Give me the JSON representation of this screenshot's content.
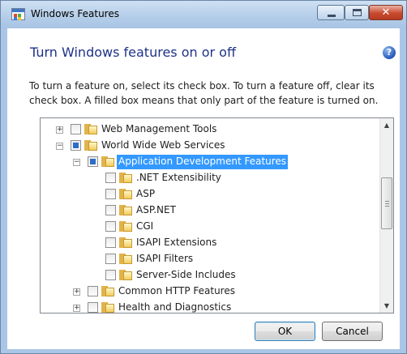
{
  "window": {
    "title": "Windows Features",
    "close_glyph": "✕"
  },
  "header": {
    "title": "Turn Windows features on or off",
    "help_glyph": "?",
    "description": "To turn a feature on, select its check box. To turn a feature off, clear its check box. A filled box means that only part of the feature is turned on."
  },
  "tree": {
    "items": [
      {
        "label": "Web Management Tools",
        "expander": "+",
        "state": "unchecked"
      },
      {
        "label": "World Wide Web Services",
        "expander": "−",
        "state": "partial"
      },
      {
        "label": "Application Development Features",
        "expander": "−",
        "state": "partial",
        "selected": true
      },
      {
        "label": ".NET Extensibility",
        "state": "unchecked"
      },
      {
        "label": "ASP",
        "state": "unchecked"
      },
      {
        "label": "ASP.NET",
        "state": "unchecked"
      },
      {
        "label": "CGI",
        "state": "unchecked"
      },
      {
        "label": "ISAPI Extensions",
        "state": "unchecked"
      },
      {
        "label": "ISAPI Filters",
        "state": "unchecked"
      },
      {
        "label": "Server-Side Includes",
        "state": "unchecked"
      },
      {
        "label": "Common HTTP Features",
        "expander": "+",
        "state": "unchecked"
      },
      {
        "label": "Health and Diagnostics",
        "expander": "+",
        "state": "unchecked"
      }
    ],
    "scroll_up_glyph": "▲",
    "scroll_down_glyph": "▼"
  },
  "footer": {
    "ok_label": "OK",
    "cancel_label": "Cancel"
  },
  "colors": {
    "selection": "#3399ff",
    "heading": "#1e3287",
    "partial_fill": "#2f6cc9"
  }
}
